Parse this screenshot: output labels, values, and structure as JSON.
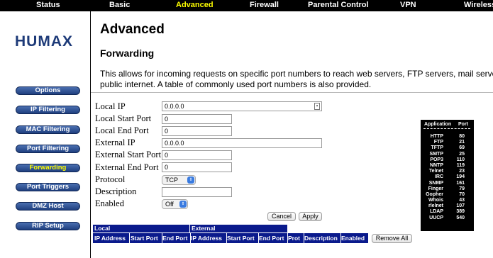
{
  "nav": {
    "tabs": [
      {
        "label": "Status",
        "active": false
      },
      {
        "label": "Basic",
        "active": false
      },
      {
        "label": "Advanced",
        "active": true
      },
      {
        "label": "Firewall",
        "active": false
      },
      {
        "label": "Parental Control",
        "active": false
      },
      {
        "label": "VPN",
        "active": false
      },
      {
        "label": "Wireless",
        "active": false
      }
    ]
  },
  "brand": {
    "logo": "HUMAX",
    "color": "#1d3a78"
  },
  "sidebar": {
    "items": [
      {
        "label": "Options",
        "active": false
      },
      {
        "label": "IP Filtering",
        "active": false
      },
      {
        "label": "MAC Filtering",
        "active": false
      },
      {
        "label": "Port Filtering",
        "active": false
      },
      {
        "label": "Forwarding",
        "active": true
      },
      {
        "label": "Port Triggers",
        "active": false
      },
      {
        "label": "DMZ Host",
        "active": false
      },
      {
        "label": "RIP Setup",
        "active": false
      }
    ]
  },
  "page": {
    "title": "Advanced",
    "subtitle": "Forwarding",
    "description_line1": "This allows for incoming requests on specific port numbers to reach web servers, FTP servers, mail servers, etc. so they can be accessible from the",
    "description_line2": "public internet. A table of commonly used port numbers is also provided."
  },
  "form": {
    "local_ip": {
      "label": "Local IP",
      "value": "0.0.0.0"
    },
    "local_start_port": {
      "label": "Local Start Port",
      "value": "0"
    },
    "local_end_port": {
      "label": "Local End Port",
      "value": "0"
    },
    "external_ip": {
      "label": "External IP",
      "value": "0.0.0.0"
    },
    "external_start_port": {
      "label": "External Start Port",
      "value": "0"
    },
    "external_end_port": {
      "label": "External End Port",
      "value": "0"
    },
    "protocol": {
      "label": "Protocol",
      "value": "TCP"
    },
    "description": {
      "label": "Description",
      "value": ""
    },
    "enabled": {
      "label": "Enabled",
      "value": "Off"
    },
    "cancel_label": "Cancel",
    "apply_label": "Apply"
  },
  "table": {
    "group_local": "Local",
    "group_external": "External",
    "columns": [
      "IP Address",
      "Start Port",
      "End Port",
      "IP Address",
      "Start Port",
      "End Port",
      "Prot",
      "Description",
      "Enabled"
    ],
    "remove_all_label": "Remove All"
  },
  "port_reference": {
    "header_application": "Application",
    "header_port": "Port",
    "rows": [
      {
        "app": "HTTP",
        "port": "80"
      },
      {
        "app": "FTP",
        "port": "21"
      },
      {
        "app": "TFTP",
        "port": "69"
      },
      {
        "app": "SMTP",
        "port": "25"
      },
      {
        "app": "POP3",
        "port": "110"
      },
      {
        "app": "NNTP",
        "port": "119"
      },
      {
        "app": "Telnet",
        "port": "23"
      },
      {
        "app": "IRC",
        "port": "194"
      },
      {
        "app": "SNMP",
        "port": "161"
      },
      {
        "app": "Finger",
        "port": "79"
      },
      {
        "app": "Gopher",
        "port": "70"
      },
      {
        "app": "Whois",
        "port": "43"
      },
      {
        "app": "rlelnet",
        "port": "107"
      },
      {
        "app": "LDAP",
        "port": "389"
      },
      {
        "app": "UUCP",
        "port": "540"
      }
    ]
  },
  "colors": {
    "nav_bg": "#000000",
    "nav_active": "#ffff00",
    "button_blue": "#1f3f7f",
    "table_header": "#0a1a8c"
  }
}
